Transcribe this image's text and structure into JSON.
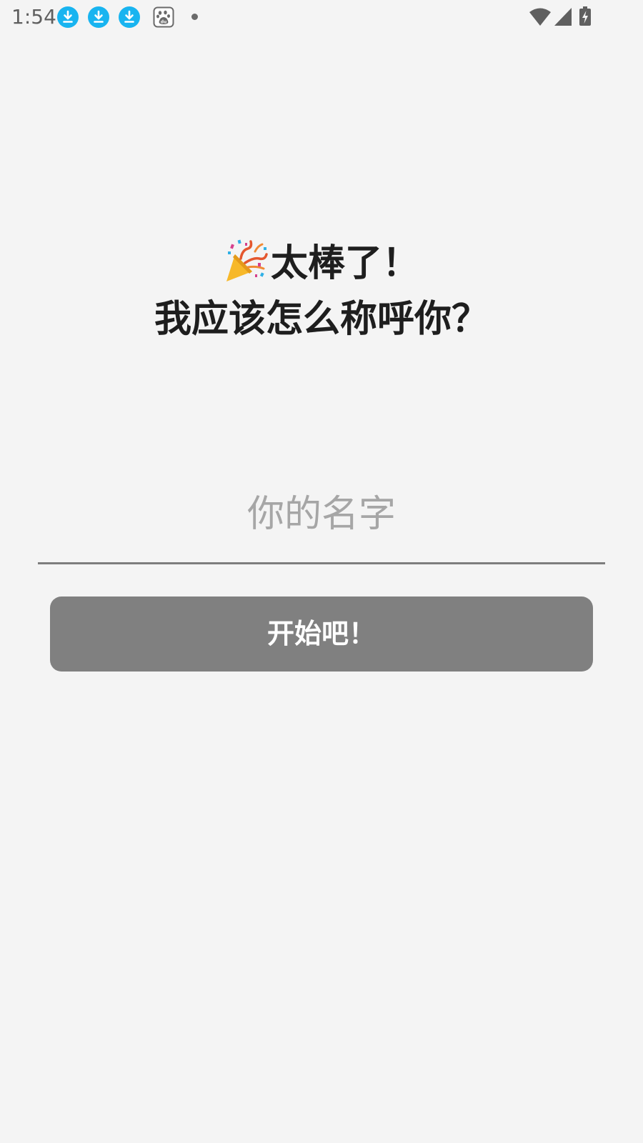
{
  "status_bar": {
    "time": "1:54",
    "notifications": [
      {
        "icon": "download-icon",
        "color": "#18b4f0"
      },
      {
        "icon": "download-icon",
        "color": "#18b4f0"
      },
      {
        "icon": "download-icon",
        "color": "#18b4f0"
      },
      {
        "icon": "baidu-icon"
      }
    ],
    "system_icons": [
      "wifi-icon",
      "cell-signal-icon",
      "battery-charging-icon"
    ]
  },
  "title": {
    "emoji": "party-popper-icon",
    "line1": "太棒了！",
    "line2": "我应该怎么称呼你？"
  },
  "name_field": {
    "placeholder": "你的名字",
    "value": ""
  },
  "start_button": {
    "label": "开始吧！",
    "color": "#808080"
  },
  "colors": {
    "background": "#f4f4f4",
    "title_text": "#1e1e1e",
    "placeholder": "#a6a6a6",
    "underline": "#7d7d7d"
  }
}
